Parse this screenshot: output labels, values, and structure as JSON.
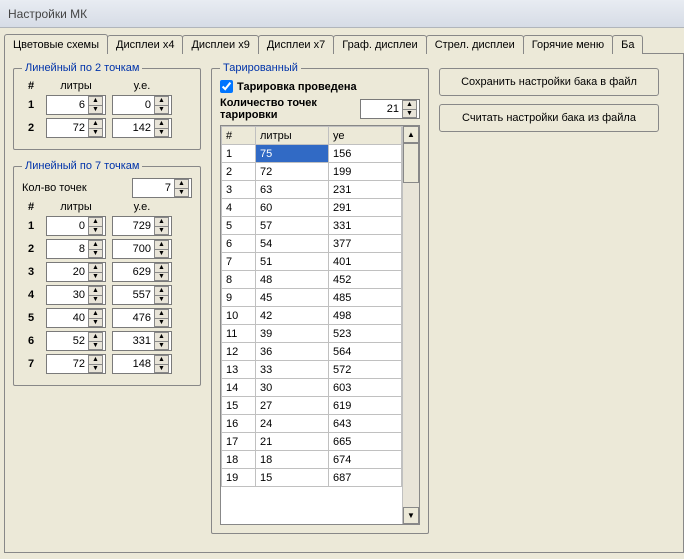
{
  "window": {
    "title": "Настройки МК"
  },
  "tabs": [
    "Цветовые схемы",
    "Дисплеи х4",
    "Дисплеи х9",
    "Дисплеи х7",
    "Граф. дисплеи",
    "Стрел. дисплеи",
    "Горячие меню",
    "Ба"
  ],
  "active_tab": 0,
  "linear2": {
    "legend": "Линейный по 2 точкам",
    "head_idx": "#",
    "head_l": "литры",
    "head_u": "у.е.",
    "rows": [
      {
        "idx": "1",
        "l": "6",
        "u": "0"
      },
      {
        "idx": "2",
        "l": "72",
        "u": "142"
      }
    ]
  },
  "linear7": {
    "legend": "Линейный по 7 точкам",
    "count_label": "Кол-во точек",
    "count_value": "7",
    "head_idx": "#",
    "head_l": "литры",
    "head_u": "у.е.",
    "rows": [
      {
        "idx": "1",
        "l": "0",
        "u": "729"
      },
      {
        "idx": "2",
        "l": "8",
        "u": "700"
      },
      {
        "idx": "3",
        "l": "20",
        "u": "629"
      },
      {
        "idx": "4",
        "l": "30",
        "u": "557"
      },
      {
        "idx": "5",
        "l": "40",
        "u": "476"
      },
      {
        "idx": "6",
        "l": "52",
        "u": "331"
      },
      {
        "idx": "7",
        "l": "72",
        "u": "148"
      }
    ]
  },
  "tared": {
    "legend": "Тарированный",
    "cb_label": "Тарировка проведена",
    "cb_checked": true,
    "qty_label": "Количество точек тарировки",
    "qty_value": "21",
    "th_idx": "#",
    "th_l": "литры",
    "th_u": "уе",
    "rows": [
      {
        "idx": "1",
        "l": "75",
        "u": "156"
      },
      {
        "idx": "2",
        "l": "72",
        "u": "199"
      },
      {
        "idx": "3",
        "l": "63",
        "u": "231"
      },
      {
        "idx": "4",
        "l": "60",
        "u": "291"
      },
      {
        "idx": "5",
        "l": "57",
        "u": "331"
      },
      {
        "idx": "6",
        "l": "54",
        "u": "377"
      },
      {
        "idx": "7",
        "l": "51",
        "u": "401"
      },
      {
        "idx": "8",
        "l": "48",
        "u": "452"
      },
      {
        "idx": "9",
        "l": "45",
        "u": "485"
      },
      {
        "idx": "10",
        "l": "42",
        "u": "498"
      },
      {
        "idx": "11",
        "l": "39",
        "u": "523"
      },
      {
        "idx": "12",
        "l": "36",
        "u": "564"
      },
      {
        "idx": "13",
        "l": "33",
        "u": "572"
      },
      {
        "idx": "14",
        "l": "30",
        "u": "603"
      },
      {
        "idx": "15",
        "l": "27",
        "u": "619"
      },
      {
        "idx": "16",
        "l": "24",
        "u": "643"
      },
      {
        "idx": "17",
        "l": "21",
        "u": "665"
      },
      {
        "idx": "18",
        "l": "18",
        "u": "674"
      },
      {
        "idx": "19",
        "l": "15",
        "u": "687"
      }
    ],
    "selected_row": 0,
    "selected_col": "l"
  },
  "buttons": {
    "save": "Сохранить настройки бака в файл",
    "load": "Считать настройки бака из файла"
  }
}
